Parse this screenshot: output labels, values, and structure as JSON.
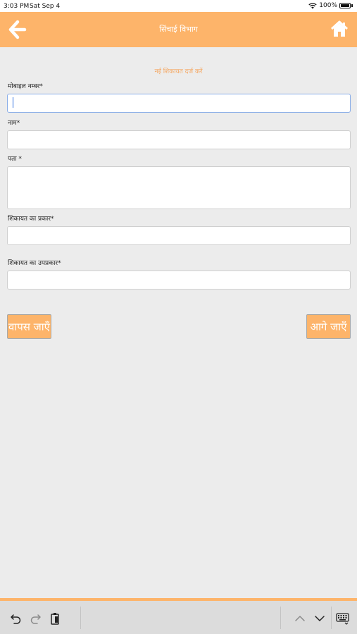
{
  "status_bar": {
    "time": "3:03 PM",
    "date": "Sat Sep 4",
    "battery": "100%"
  },
  "header": {
    "title": "सिंचाई विभाग",
    "back_icon": "arrow-left-icon",
    "home_icon": "home-icon",
    "background": "#fdb46a"
  },
  "form": {
    "heading": "नई शिकायत दर्ज करें",
    "fields": [
      {
        "label": "मोबाइल नम्बर*",
        "value": "",
        "focused": true
      },
      {
        "label": "नाम*",
        "value": ""
      },
      {
        "label": "पता *",
        "value": ""
      },
      {
        "label": "शिकायत का प्रकार*",
        "value": ""
      },
      {
        "label": "शिकायत का उपप्रकार*",
        "value": ""
      }
    ]
  },
  "buttons": {
    "back": "वापस जाएँ",
    "next": "आगे जाएँ"
  },
  "keyboard_toolbar": {
    "icons": [
      "undo-icon",
      "redo-icon",
      "paste-icon",
      "chevron-up-icon",
      "chevron-down-icon",
      "keyboard-icon"
    ]
  },
  "colors": {
    "accent": "#fdb46a",
    "heading_text": "#f5a65f",
    "background": "#ececec"
  }
}
